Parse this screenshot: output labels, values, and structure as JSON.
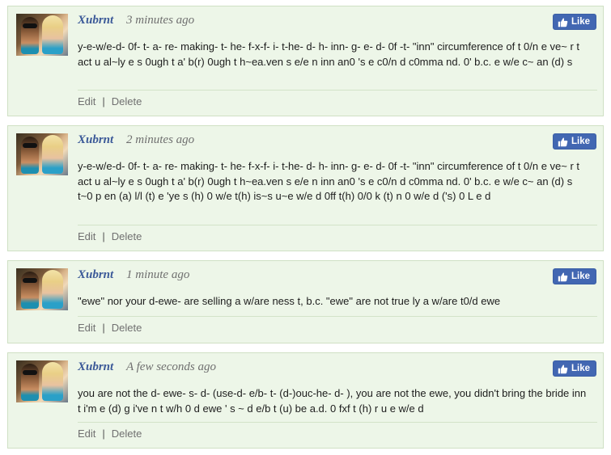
{
  "comments": [
    {
      "username": "Xubrnt",
      "timestamp": "3 minutes ago",
      "like_label": "Like",
      "text": "y-e-w/e-d- 0f- t- a- re- making- t- he- f-x-f- i- t-he- d- h- inn- g- e- d- 0f -t- \"inn\" circumference of t 0/n e ve~ r t act u al~ly e s 0ugh t a' b(r) 0ugh t h~ea.ven s e/e n inn an0 's e c0/n d c0mma nd. 0' b.c. e w/e c~ an (d) s",
      "edit_label": "Edit",
      "separator": "|",
      "delete_label": "Delete"
    },
    {
      "username": "Xubrnt",
      "timestamp": "2 minutes ago",
      "like_label": "Like",
      "text": "y-e-w/e-d- 0f- t- a- re- making- t- he- f-x-f- i- t-he- d- h- inn- g- e- d- 0f -t- \"inn\" circumference of t 0/n e ve~ r t act u al~ly e s 0ugh t a' b(r) 0ugh t h~ea.ven s e/e n inn an0 's e c0/n d c0mma nd. 0' b.c. e w/e c~ an (d) s t~0 p en (a) l/l (t) e 'ye s (h) 0 w/e t(h) is~s u~e w/e d 0ff t(h) 0/0 k (t) n 0 w/e d ('s) 0 L e d",
      "edit_label": "Edit",
      "separator": "|",
      "delete_label": "Delete"
    },
    {
      "username": "Xubrnt",
      "timestamp": "1 minute ago",
      "like_label": "Like",
      "text": "\"ewe\" nor your d-ewe- are selling a w/are ness t, b.c. \"ewe\" are not true ly a w/are t0/d ewe",
      "edit_label": "Edit",
      "separator": "|",
      "delete_label": "Delete"
    },
    {
      "username": "Xubrnt",
      "timestamp": "A few seconds ago",
      "like_label": "Like",
      "text": "you are not the d- ewe- s- d- (use-d- e/b- t- (d-)ouc-he- d- ), you are not the ewe, you didn't bring the bride inn t i'm e (d) g i've n t w/h 0 d ewe ' s ~ d e/b t (u) be a.d. 0 fxf t (h) r u e w/e d",
      "edit_label": "Edit",
      "separator": "|",
      "delete_label": "Delete"
    }
  ],
  "colors": {
    "card_bg": "#edf6e8",
    "card_border": "#cfe0c4",
    "username": "#3b5998",
    "like_button": "#4267b2"
  },
  "icons": {
    "like": "thumbs-up-icon"
  }
}
